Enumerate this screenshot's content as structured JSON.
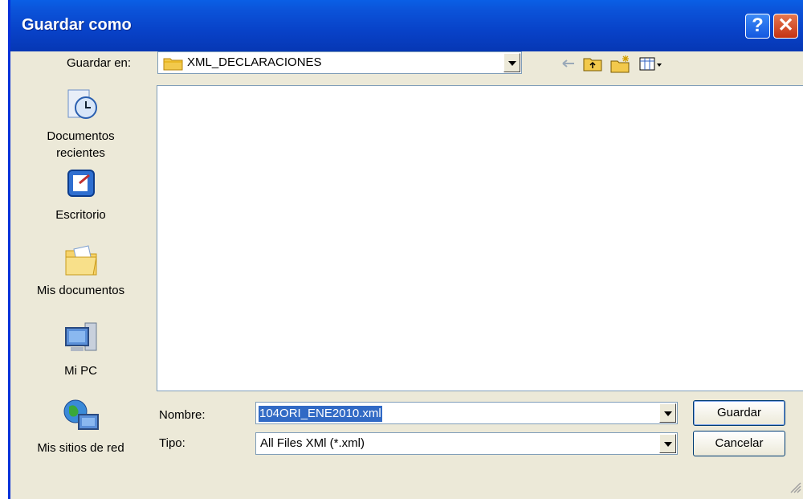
{
  "window": {
    "title": "Guardar como"
  },
  "titlebar": {
    "help_label": "?",
    "close_label": "✕"
  },
  "location": {
    "label": "Guardar en:",
    "folder": "XML_DECLARACIONES"
  },
  "toolbar": {
    "icons": [
      "back-arrow-icon",
      "up-folder-icon",
      "new-folder-icon",
      "view-menu-icon"
    ]
  },
  "places": [
    {
      "label_line1": "Documentos",
      "label_line2": "recientes",
      "icon": "recent-documents-icon"
    },
    {
      "label_line1": "Escritorio",
      "label_line2": "",
      "icon": "desktop-icon"
    },
    {
      "label_line1": "Mis documentos",
      "label_line2": "",
      "icon": "my-documents-icon"
    },
    {
      "label_line1": "Mi PC",
      "label_line2": "",
      "icon": "my-computer-icon"
    },
    {
      "label_line1": "Mis sitios de red",
      "label_line2": "",
      "icon": "network-places-icon"
    }
  ],
  "filename": {
    "label": "Nombre:",
    "value": "104ORI_ENE2010.xml"
  },
  "filetype": {
    "label": "Tipo:",
    "value": "All Files XMl (*.xml)"
  },
  "buttons": {
    "save": "Guardar",
    "cancel": "Cancelar"
  },
  "colors": {
    "titlebar": "#0842c8",
    "dialog_bg": "#ece9d8",
    "selection": "#316ac5"
  }
}
